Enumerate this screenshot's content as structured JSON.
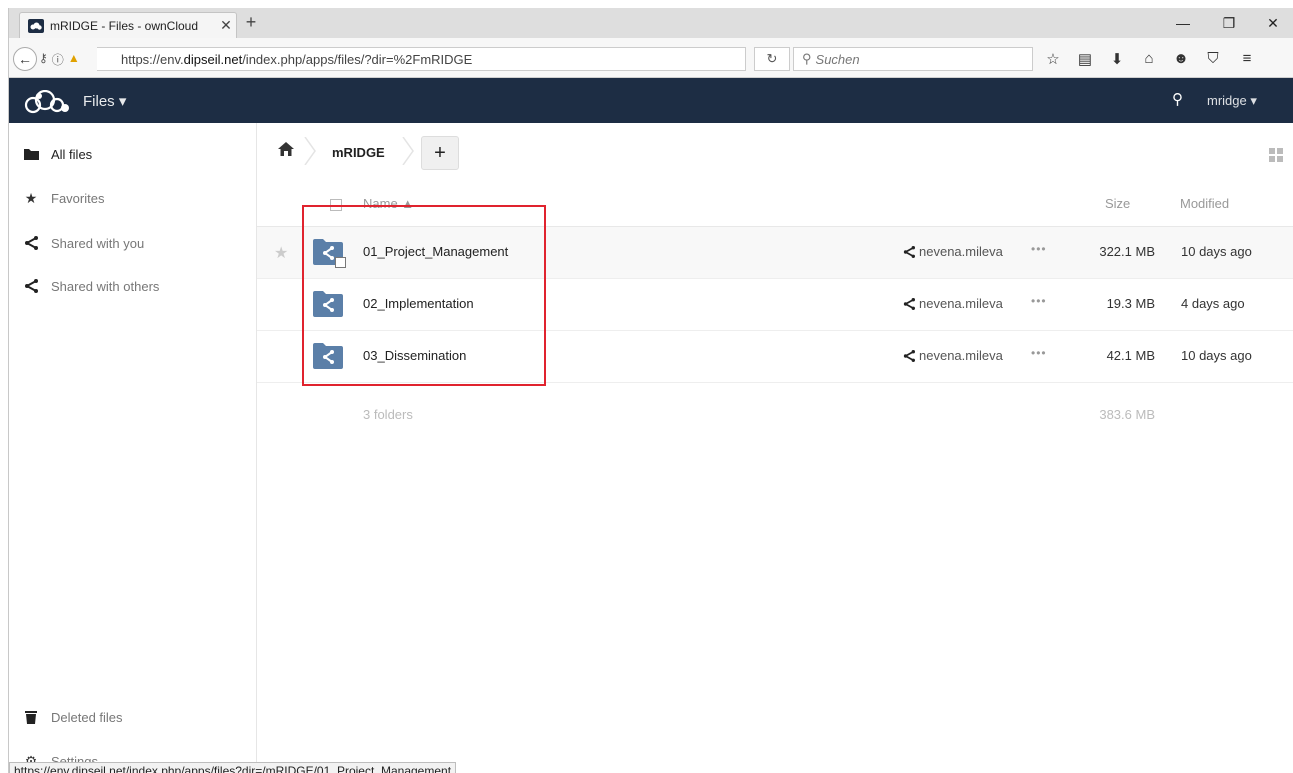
{
  "browser": {
    "tab_title": "mRIDGE - Files - ownCloud",
    "tab_close": "✕",
    "new_tab": "+",
    "url_prefix": "https://env.",
    "url_host": "dipseil.net",
    "url_path": "/index.php/apps/files/?dir=%2FmRIDGE",
    "search_placeholder": "Suchen",
    "window_controls": [
      "—",
      "❐",
      "✕"
    ]
  },
  "header": {
    "app_name": "Files ▾",
    "user": "mridge ▾"
  },
  "sidebar": {
    "items": [
      {
        "label": "All files",
        "icon": "folder-icon"
      },
      {
        "label": "Favorites",
        "icon": "star-icon"
      },
      {
        "label": "Shared with you",
        "icon": "share-icon"
      },
      {
        "label": "Shared with others",
        "icon": "share-icon"
      }
    ],
    "deleted": "Deleted files",
    "settings": "Settings"
  },
  "breadcrumb": {
    "current": "mRIDGE",
    "add": "+"
  },
  "table": {
    "headers": {
      "name": "Name ▲",
      "size": "Size",
      "modified": "Modified"
    },
    "rows": [
      {
        "name": "01_Project_Management",
        "owner": "nevena.mileva",
        "size": "322.1 MB",
        "modified": "10 days ago"
      },
      {
        "name": "02_Implementation",
        "owner": "nevena.mileva",
        "size": "19.3 MB",
        "modified": "4 days ago"
      },
      {
        "name": "03_Dissemination",
        "owner": "nevena.mileva",
        "size": "42.1 MB",
        "modified": "10 days ago"
      }
    ],
    "more": "•••",
    "summary_count": "3 folders",
    "summary_size": "383.6 MB"
  },
  "status_url": "https://env.dipseil.net/index.php/apps/files?dir=/mRIDGE/01_Project_Management",
  "colors": {
    "header_bg": "#1d2d44",
    "folder_blue": "#5b7fa8",
    "highlight_red": "#e0232e"
  }
}
